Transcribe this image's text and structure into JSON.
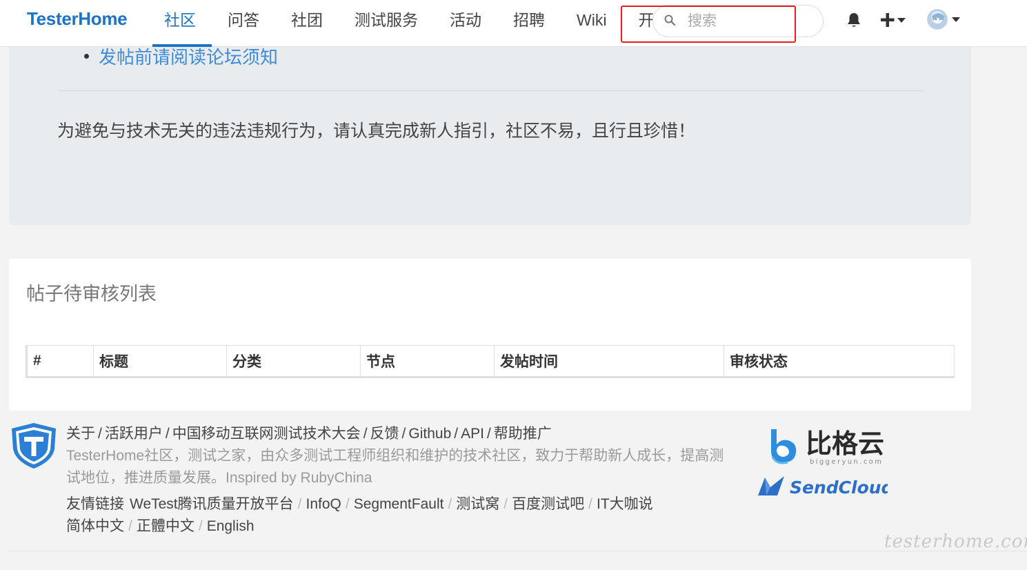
{
  "navbar": {
    "brand": "TesterHome",
    "items": [
      {
        "label": "社区",
        "active": true
      },
      {
        "label": "问答",
        "active": false
      },
      {
        "label": "社团",
        "active": false
      },
      {
        "label": "测试服务",
        "active": false
      },
      {
        "label": "活动",
        "active": false
      },
      {
        "label": "招聘",
        "active": false
      },
      {
        "label": "Wiki",
        "active": false
      },
      {
        "label": "开源项目",
        "active": false
      }
    ],
    "search_placeholder": "搜索",
    "icons": [
      "search-icon",
      "bell-icon",
      "plus-icon",
      "avatar"
    ],
    "accent_color": "#1e73c9",
    "highlight_color": "#e0201f"
  },
  "notice": {
    "link": "发帖前请阅读论坛须知",
    "text": "为避免与技术无关的违法违规行为，请认真完成新人指引，社区不易，且行且珍惜！"
  },
  "review": {
    "title": "帖子待审核列表",
    "columns": [
      "#",
      "标题",
      "分类",
      "节点",
      "发帖时间",
      "审核状态"
    ],
    "rows": []
  },
  "footer": {
    "links": [
      "关于",
      "活跃用户",
      "中国移动互联网测试技术大会",
      "反馈",
      "Github",
      "API",
      "帮助推广"
    ],
    "description": "TesterHome社区，测试之家，由众多测试工程师组织和维护的技术社区，致力于帮助新人成长，提高测试地位，推进质量发展。Inspired by RubyChina",
    "friend_label": "友情链接",
    "friend_links": [
      "WeTest腾讯质量开放平台",
      "InfoQ",
      "SegmentFault",
      "测试窝",
      "百度测试吧",
      "IT大咖说"
    ],
    "languages": [
      "简体中文",
      "正體中文",
      "English"
    ],
    "sponsors": {
      "bigger_name": "比格云",
      "bigger_domain": "biggeryun.com",
      "send_name": "SendCloud"
    }
  },
  "watermark": "testerhome.com"
}
